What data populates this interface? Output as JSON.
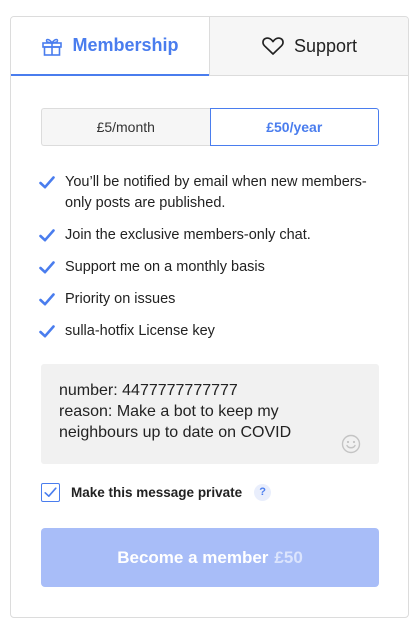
{
  "tabs": {
    "membership_label": "Membership",
    "support_label": "Support"
  },
  "pricing": {
    "monthly_label": "£5/month",
    "yearly_label": "£50/year",
    "selected": "yearly"
  },
  "benefits": [
    "You’ll be notified by email when new members-only posts are published.",
    "Join the exclusive members-only chat.",
    "Support me on a monthly basis",
    "Priority on issues",
    "sulla-hotfix License key"
  ],
  "message": {
    "value": "number: 4477777777777\nreason: Make a bot to keep my neighbours up to date on COVID"
  },
  "private": {
    "label": "Make this message private",
    "checked": true,
    "help_symbol": "?"
  },
  "cta": {
    "label": "Become a member",
    "price": "£50"
  },
  "colors": {
    "accent": "#4a7dee",
    "cta_background": "#a8bdf8",
    "input_background": "#f1f1f1"
  },
  "icons": {
    "membership_tab": "gift-icon",
    "support_tab": "heart-icon",
    "benefit": "checkmark-icon",
    "emoji": "smiley-icon",
    "help": "question-icon"
  }
}
